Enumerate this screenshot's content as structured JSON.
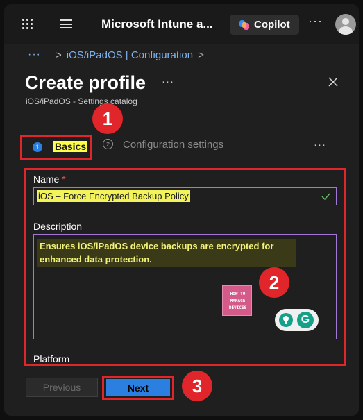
{
  "topbar": {
    "app_title": "Microsoft Intune a...",
    "copilot_label": "Copilot",
    "more": "···"
  },
  "breadcrumb": {
    "more": "···",
    "separator": ">",
    "item": "iOS/iPadOS | Configuration"
  },
  "page": {
    "title": "Create profile",
    "title_more": "···",
    "subtitle": "iOS/iPadOS - Settings catalog"
  },
  "tabs": [
    {
      "step": "1",
      "label": "Basics"
    },
    {
      "step": "2",
      "label": "Configuration settings"
    }
  ],
  "tabs_more": "···",
  "form": {
    "name_label": "Name",
    "required_mark": "*",
    "name_value": "iOS – Force Encrypted Backup Policy",
    "description_label": "Description",
    "description_value": "Ensures iOS/iPadOS device backups are encrypted for enhanced data protection.",
    "platform_label": "Platform"
  },
  "logo": {
    "lines": [
      "HOW TO",
      "MANAGE",
      "DEVICES"
    ]
  },
  "grammarly": {
    "letter": "G"
  },
  "annotations": [
    "1",
    "2",
    "3"
  ],
  "footer": {
    "previous_label": "Previous",
    "next_label": "Next"
  },
  "colors": {
    "accent_blue": "#2a7fe0",
    "annotation_red": "#e0262b",
    "highlight_yellow": "#f2f25a",
    "input_border_purple": "#a277d6"
  }
}
